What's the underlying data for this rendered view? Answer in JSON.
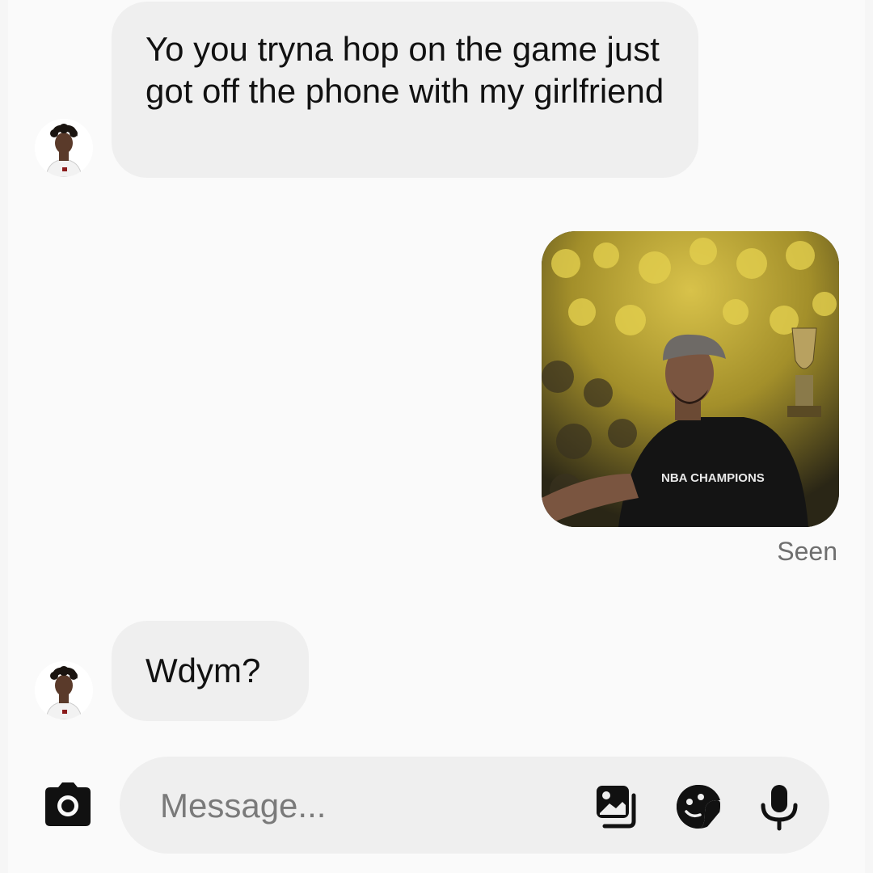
{
  "thread": {
    "messages": [
      {
        "direction": "incoming",
        "type": "text",
        "text": "Yo you tryna hop on the game just got off the phone with my girlfriend"
      },
      {
        "direction": "outgoing",
        "type": "image",
        "image_subject": "basketball player holding trophy in arena crowd",
        "shirt_text": "NBA CHAMPIONS"
      },
      {
        "direction": "incoming",
        "type": "text",
        "text": "Wdym?"
      }
    ],
    "seen_label": "Seen"
  },
  "composer": {
    "placeholder": "Message...",
    "icons": [
      "camera-icon",
      "gallery-icon",
      "sticker-icon",
      "microphone-icon"
    ]
  },
  "colors": {
    "incoming_bubble": "#efefef",
    "background": "#fafafa",
    "icon": "#111111",
    "seen_text": "#6f6f6f"
  }
}
